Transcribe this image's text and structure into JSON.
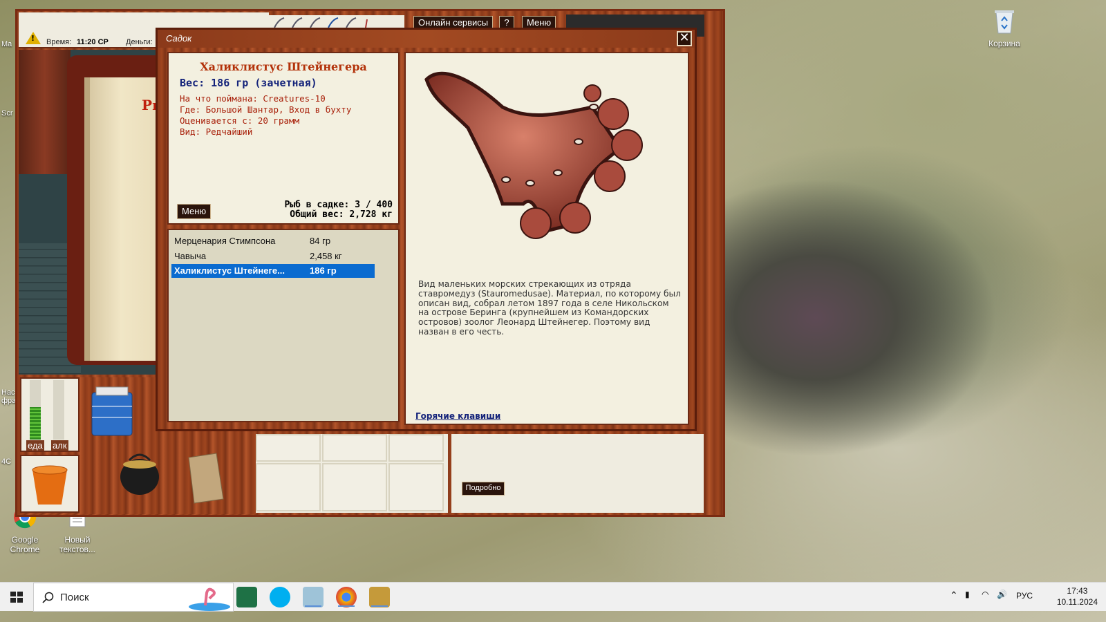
{
  "desktop": {
    "recycle_bin_label": "Корзина",
    "chrome_label": "Google Chrome",
    "new_text_label": "Новый текстов...",
    "left_strip": [
      "Ma",
      "Scr",
      "Нас фра",
      "4C"
    ]
  },
  "game": {
    "topbar": {
      "time_label": "Время:",
      "time_value": "11:20 СР",
      "money_label": "Деньги:"
    },
    "online_services_label": "Онлайн сервисы",
    "help_label": "?",
    "menu_label": "Меню",
    "scene_sign": "Ры",
    "meters": [
      {
        "label": "еда",
        "level": 0.55
      },
      {
        "label": "алк",
        "level": 0.0
      }
    ],
    "details_button": "Подробно"
  },
  "dialog": {
    "title": "Садок",
    "close_icon": "close-icon",
    "fish": {
      "name": "Халиклистус Штейнегера",
      "weight_line": "Вес: 186 гр (зачетная)",
      "caught_on": "На что поймана: Creatures-10",
      "location": "Где: Большой Шантар, Вход в бухту",
      "valued_from": "Оценивается с: 20 грамм",
      "kind": "Вид: Редчайший"
    },
    "menu_button": "Меню",
    "count_line": "Рыб в садке: 3 / 400",
    "total_weight_line": "Общий вес: 2,728 кг",
    "list": [
      {
        "name": "Мерценария Стимпсона",
        "weight": "84 гр",
        "selected": false
      },
      {
        "name": "Чавыча",
        "weight": "2,458 кг",
        "selected": false
      },
      {
        "name": "Халиклистус Штейнеге...",
        "weight": "186 гр",
        "selected": true
      }
    ],
    "description": "Вид маленьких морских стрекающих из отряда ставромедуз (Stauromedusae). Материал, по которому был описан вид, собрал летом 1897 года в селе Никольском на острове Беринга (крупнейшем из Командорских островов) зоолог Леонард Штейнегер. Поэтому вид назван в его честь.",
    "hotkeys_link": "Горячие клавиши"
  },
  "taskbar": {
    "search_placeholder": "Поиск",
    "language": "РУС",
    "time": "17:43",
    "date": "10.11.2024"
  },
  "colors": {
    "wood": "#8b3a1a",
    "panel": "#f3f0e0",
    "fish_name": "#b3320a",
    "selection": "#0a6bd0",
    "link": "#14237a"
  }
}
